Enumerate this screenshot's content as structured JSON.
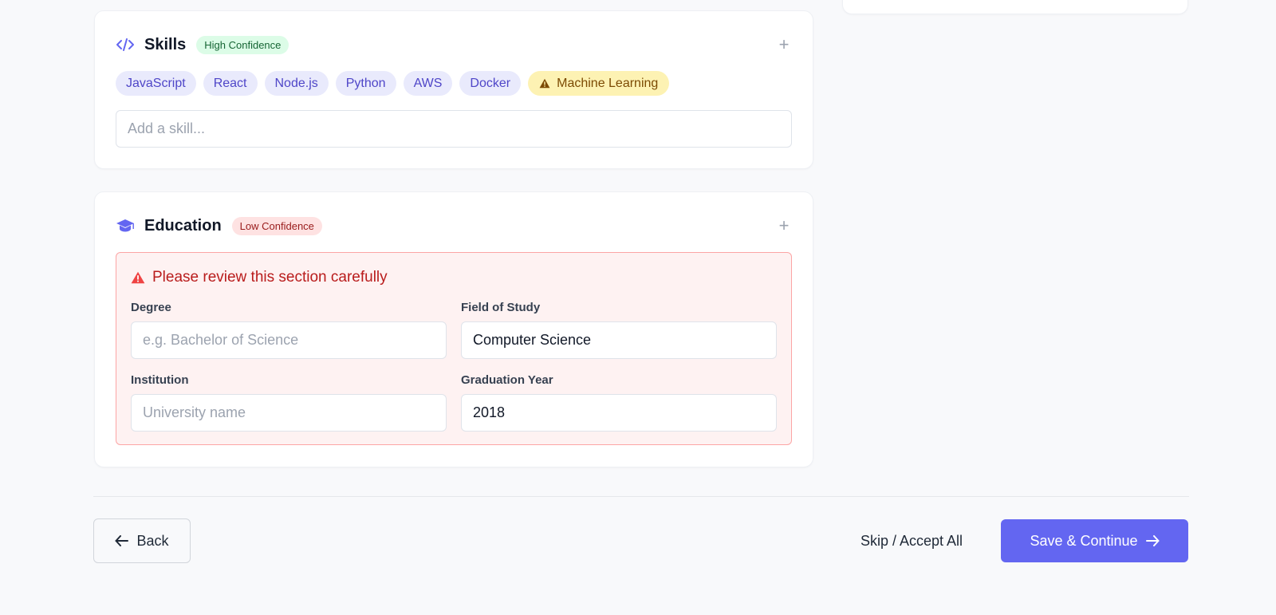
{
  "skills": {
    "title": "Skills",
    "confidence": "High Confidence",
    "icon": "code-icon",
    "chips": [
      {
        "label": "JavaScript"
      },
      {
        "label": "React"
      },
      {
        "label": "Node.js"
      },
      {
        "label": "Python"
      },
      {
        "label": "AWS"
      },
      {
        "label": "Docker"
      }
    ],
    "flagged_chip": {
      "label": "Machine Learning",
      "icon": "warning-icon"
    },
    "input_placeholder": "Add a skill..."
  },
  "education": {
    "title": "Education",
    "confidence": "Low Confidence",
    "icon": "graduation-cap-icon",
    "review_message": "Please review this section carefully",
    "fields": {
      "degree": {
        "label": "Degree",
        "value": "",
        "placeholder": "e.g. Bachelor of Science"
      },
      "field_of_study": {
        "label": "Field of Study",
        "value": "Computer Science",
        "placeholder": ""
      },
      "institution": {
        "label": "Institution",
        "value": "",
        "placeholder": "University name"
      },
      "graduation_year": {
        "label": "Graduation Year",
        "value": "2018",
        "placeholder": ""
      }
    }
  },
  "footer": {
    "back_label": "Back",
    "skip_label": "Skip / Accept All",
    "save_label": "Save & Continue"
  },
  "colors": {
    "accent": "#6366f1",
    "high_confidence_bg": "#dcfce7",
    "low_confidence_bg": "#fee2e2",
    "warning_chip_bg": "#fdf2b3",
    "error_text": "#b91c1c"
  }
}
